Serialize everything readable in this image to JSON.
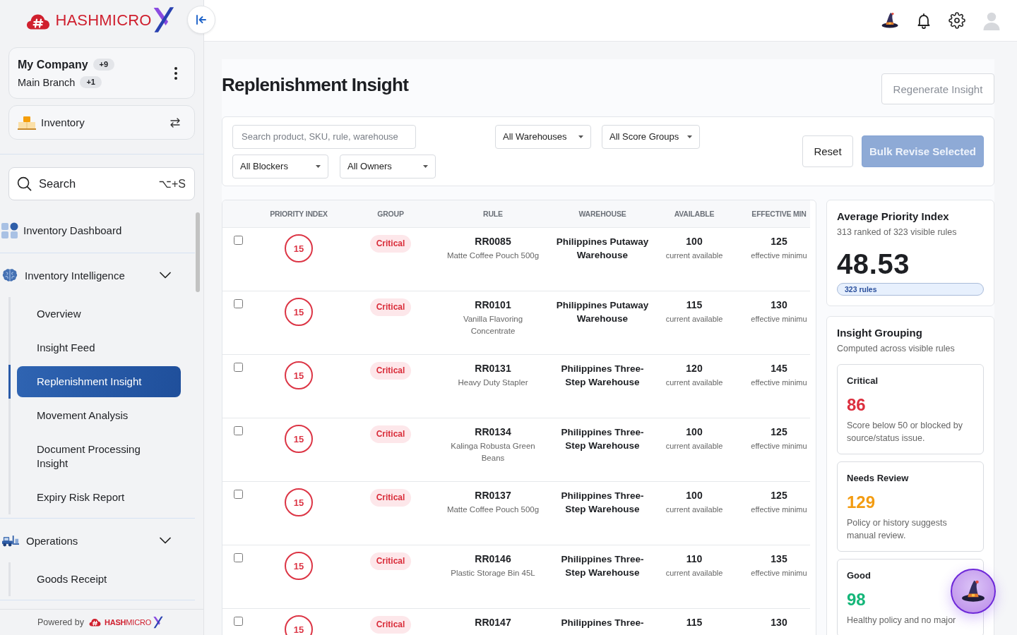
{
  "sidebar": {
    "logo": {
      "text": "HASHMICRO"
    },
    "company": {
      "name": "My Company",
      "name_count": "+9",
      "branch": "Main Branch",
      "branch_count": "+1"
    },
    "module": {
      "label": "Inventory"
    },
    "search": {
      "placeholder": "Search",
      "shortcut": "⌥+S"
    },
    "nav": [
      {
        "kind": "link",
        "label": "Inventory Dashboard",
        "selected": false
      },
      {
        "kind": "group",
        "label": "Inventory Intelligence",
        "expanded": true,
        "children": [
          {
            "label": "Overview",
            "selected": false
          },
          {
            "label": "Insight Feed",
            "selected": false
          },
          {
            "label": "Replenishment Insight",
            "selected": true
          },
          {
            "label": "Movement Analysis",
            "selected": false
          },
          {
            "label": "Document Processing Insight",
            "selected": false
          },
          {
            "label": "Expiry Risk Report",
            "selected": false
          }
        ]
      },
      {
        "kind": "group",
        "label": "Operations",
        "expanded": true,
        "children": [
          {
            "label": "Goods Receipt",
            "selected": false
          }
        ]
      }
    ],
    "footer": {
      "text": "Powered by",
      "brand": "**HASH**MICRO"
    }
  },
  "page": {
    "title": "Replenishment Insight",
    "regenerate_button": "Regenerate Insight"
  },
  "filters": {
    "search": {
      "placeholder": "Search product, SKU, rule, warehouse"
    },
    "dropdowns": [
      "All Warehouses",
      "All Score Groups",
      "All Blockers",
      "All Owners"
    ],
    "reset_button": "Reset",
    "bulk_button": {
      "label": "Bulk Revise Selected",
      "disabled": true
    }
  },
  "table": {
    "columns": [
      "PRIORITY INDEX",
      "GROUP",
      "RULE",
      "WAREHOUSE",
      "AVAILABLE",
      "EFFECTIVE MIN"
    ],
    "rows": [
      {
        "checked": false,
        "score": "15",
        "group": "Critical",
        "rule": "RR0085",
        "product": "Matte Coffee Pouch 500g",
        "warehouse": "Philippines Putaway Warehouse",
        "available": "100",
        "available_note": "current available",
        "minimum": "125",
        "minimum_note": "effective minimu"
      },
      {
        "checked": false,
        "score": "15",
        "group": "Critical",
        "rule": "RR0101",
        "product": "Vanilla Flavoring Concentrate",
        "warehouse": "Philippines Putaway Warehouse",
        "available": "115",
        "available_note": "current available",
        "minimum": "130",
        "minimum_note": "effective minimu"
      },
      {
        "checked": false,
        "score": "15",
        "group": "Critical",
        "rule": "RR0131",
        "product": "Heavy Duty Stapler",
        "warehouse": "Philippines Three-Step Warehouse",
        "available": "120",
        "available_note": "current available",
        "minimum": "145",
        "minimum_note": "effective minimu"
      },
      {
        "checked": false,
        "score": "15",
        "group": "Critical",
        "rule": "RR0134",
        "product": "Kalinga Robusta Green Beans",
        "warehouse": "Philippines Three-Step Warehouse",
        "available": "100",
        "available_note": "current available",
        "minimum": "125",
        "minimum_note": "effective minimu"
      },
      {
        "checked": false,
        "score": "15",
        "group": "Critical",
        "rule": "RR0137",
        "product": "Matte Coffee Pouch 500g",
        "warehouse": "Philippines Three-Step Warehouse",
        "available": "100",
        "available_note": "current available",
        "minimum": "125",
        "minimum_note": "effective minimu"
      },
      {
        "checked": false,
        "score": "15",
        "group": "Critical",
        "rule": "RR0146",
        "product": "Plastic Storage Bin 45L",
        "warehouse": "Philippines Three-Step Warehouse",
        "available": "110",
        "available_note": "current available",
        "minimum": "135",
        "minimum_note": "effective minimu"
      },
      {
        "checked": false,
        "score": "15",
        "group": "Critical",
        "rule": "RR0147",
        "warehouse": "Philippines Three-",
        "available": "115",
        "minimum": "130"
      }
    ]
  },
  "summary": {
    "title": "Average Priority Index",
    "subtitle": "313 ranked of 323 visible rules",
    "value": "48.53",
    "badge": "323 rules"
  },
  "grouping": {
    "title": "Insight Grouping",
    "subtitle": "Computed across visible rules",
    "groups": [
      {
        "label": "Critical",
        "count": "86",
        "color": "#dc2f3e",
        "description": "Score below 50 or blocked by source/status issue."
      },
      {
        "label": "Needs Review",
        "count": "129",
        "color": "#f39c12",
        "description": "Policy or history suggests manual review."
      },
      {
        "label": "Good",
        "count": "98",
        "color": "#14b679",
        "description": "Healthy policy and no major"
      }
    ]
  }
}
